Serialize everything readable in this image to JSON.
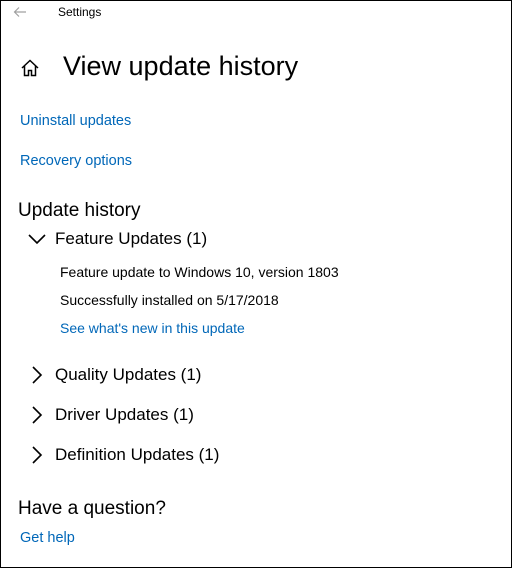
{
  "window": {
    "title": "Settings"
  },
  "page": {
    "title": "View update history"
  },
  "links": {
    "uninstall": "Uninstall updates",
    "recovery": "Recovery options"
  },
  "history": {
    "heading": "Update history",
    "groups": [
      {
        "label": "Feature Updates (1)",
        "expanded": true,
        "entries": [
          {
            "name": "Feature update to Windows 10, version 1803",
            "status": "Successfully installed on 5/17/2018",
            "link": "See what's new in this update"
          }
        ]
      },
      {
        "label": "Quality Updates (1)",
        "expanded": false
      },
      {
        "label": "Driver Updates (1)",
        "expanded": false
      },
      {
        "label": "Definition Updates (1)",
        "expanded": false
      }
    ]
  },
  "question": {
    "heading": "Have a question?",
    "help_link": "Get help"
  },
  "colors": {
    "accent": "#0067b8",
    "text": "#000000",
    "muted_icon": "#a0a0a0"
  },
  "icons": [
    "back-arrow-icon",
    "home-icon",
    "chevron-down-icon",
    "chevron-right-icon"
  ]
}
